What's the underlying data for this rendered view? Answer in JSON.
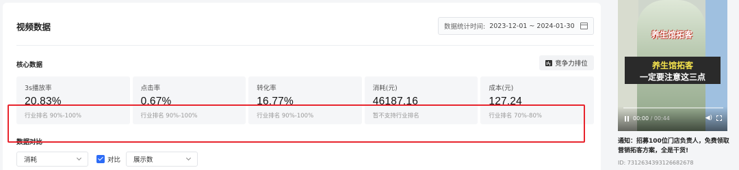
{
  "header": {
    "title": "视频数据",
    "date_label": "数据统计时间:",
    "date_range": "2023-12-01 ~ 2024-01-30"
  },
  "core": {
    "title": "核心数据",
    "rank_button": "竞争力排位"
  },
  "metrics": [
    {
      "label": "3s播放率",
      "value": "20.83%",
      "rank": "行业排名 90%-100%"
    },
    {
      "label": "点击率",
      "value": "0.67%",
      "rank": "行业排名 90%-100%"
    },
    {
      "label": "转化率",
      "value": "16.77%",
      "rank": "行业排名 90%-100%"
    },
    {
      "label": "消耗(元)",
      "value": "46187.16",
      "rank": "暂不支持行业排名"
    },
    {
      "label": "成本(元)",
      "value": "127.24",
      "rank": "行业排名 70%-80%"
    }
  ],
  "compare": {
    "title": "数据对比",
    "select1": "消耗",
    "checkbox_label": "对比",
    "checkbox_checked": true,
    "select2": "展示数"
  },
  "video": {
    "sign_text": "养生馆拓客",
    "banner_line1": "养生馆拓客",
    "banner_line2": "一定要注意这三点",
    "time_current": "00:00",
    "time_total": "00:44",
    "progress": 0
  },
  "notice": "通知：招募100位门店负责人，免费领取营销拓客方案，全是干货!",
  "video_id": "ID: 7312634393126682678",
  "colors": {
    "accent": "#2d6cf6",
    "highlight_border": "#e8232c"
  }
}
